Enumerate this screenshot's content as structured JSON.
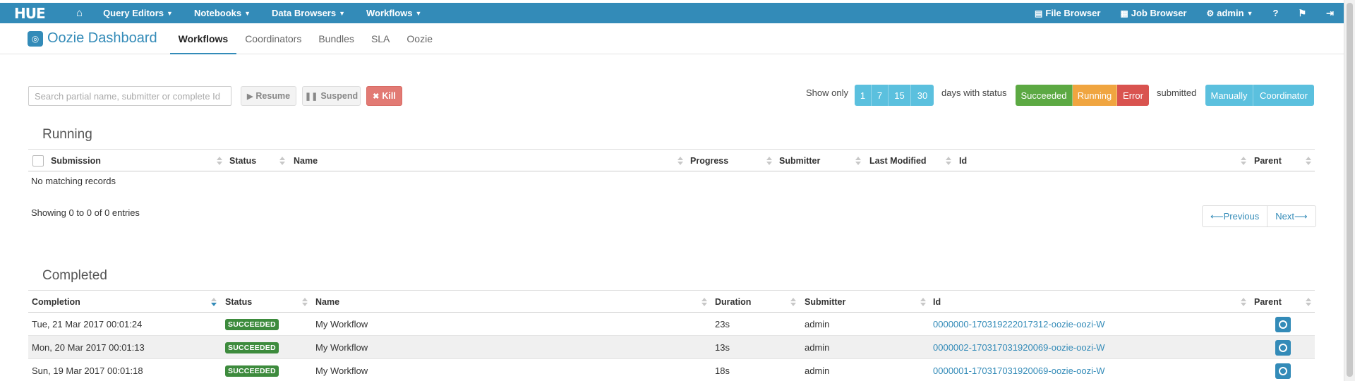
{
  "navbar": {
    "brand": "HUE",
    "menus": [
      {
        "label": "Query Editors"
      },
      {
        "label": "Notebooks"
      },
      {
        "label": "Data Browsers"
      },
      {
        "label": "Workflows"
      }
    ],
    "right": {
      "file_browser": "File Browser",
      "job_browser": "Job Browser",
      "user": "admin"
    }
  },
  "subheader": {
    "title": "Oozie Dashboard",
    "tabs": [
      "Workflows",
      "Coordinators",
      "Bundles",
      "SLA",
      "Oozie"
    ],
    "active_tab": "Workflows"
  },
  "toolbar": {
    "search_placeholder": "Search partial name, submitter or complete Id",
    "resume": "Resume",
    "suspend": "Suspend",
    "kill": "Kill",
    "show_only": "Show only",
    "days": [
      "1",
      "7",
      "15",
      "30"
    ],
    "days_with_status": "days with status",
    "statuses": [
      "Succeeded",
      "Running",
      "Error"
    ],
    "submitted": "submitted",
    "submitted_by": [
      "Manually",
      "Coordinator"
    ]
  },
  "running": {
    "title": "Running",
    "columns": [
      "Submission",
      "Status",
      "Name",
      "Progress",
      "Submitter",
      "Last Modified",
      "Id",
      "Parent"
    ],
    "empty": "No matching records",
    "showing": "Showing 0 to 0 of 0 entries",
    "prev": "Previous",
    "next": "Next"
  },
  "completed": {
    "title": "Completed",
    "columns": [
      "Completion",
      "Status",
      "Name",
      "Duration",
      "Submitter",
      "Id",
      "Parent"
    ],
    "rows": [
      {
        "completion": "Tue, 21 Mar 2017 00:01:24",
        "status": "SUCCEEDED",
        "name": "My Workflow",
        "duration": "23s",
        "submitter": "admin",
        "id": "0000000-170319222017312-oozie-oozi-W"
      },
      {
        "completion": "Mon, 20 Mar 2017 00:01:13",
        "status": "SUCCEEDED",
        "name": "My Workflow",
        "duration": "13s",
        "submitter": "admin",
        "id": "0000002-170317031920069-oozie-oozi-W"
      },
      {
        "completion": "Sun, 19 Mar 2017 00:01:18",
        "status": "SUCCEEDED",
        "name": "My Workflow",
        "duration": "18s",
        "submitter": "admin",
        "id": "0000001-170317031920069-oozie-oozi-W"
      }
    ]
  },
  "colors": {
    "brand": "#338bb8",
    "success": "#5ca943",
    "warning": "#f0a540",
    "danger": "#d9534f",
    "info": "#5bc0de"
  }
}
